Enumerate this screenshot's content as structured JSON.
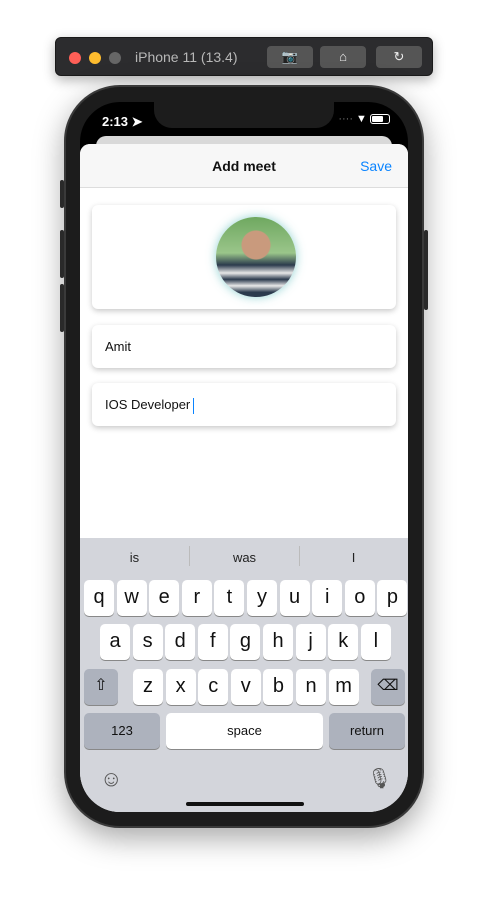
{
  "simulator": {
    "title": "iPhone 11 (13.4)",
    "buttons": [
      "screenshot",
      "home",
      "rotate"
    ]
  },
  "status_bar": {
    "time": "2:13"
  },
  "nav": {
    "title": "Add meet",
    "save_label": "Save"
  },
  "form": {
    "name_value": "Amit",
    "role_value": "IOS Developer"
  },
  "keyboard": {
    "suggestions": [
      "is",
      "was",
      "I"
    ],
    "row1": [
      "q",
      "w",
      "e",
      "r",
      "t",
      "y",
      "u",
      "i",
      "o",
      "p"
    ],
    "row2": [
      "a",
      "s",
      "d",
      "f",
      "g",
      "h",
      "j",
      "k",
      "l"
    ],
    "row3": [
      "z",
      "x",
      "c",
      "v",
      "b",
      "n",
      "m"
    ],
    "numbers_label": "123",
    "space_label": "space",
    "return_label": "return"
  },
  "colors": {
    "accent": "#0a84ff"
  }
}
